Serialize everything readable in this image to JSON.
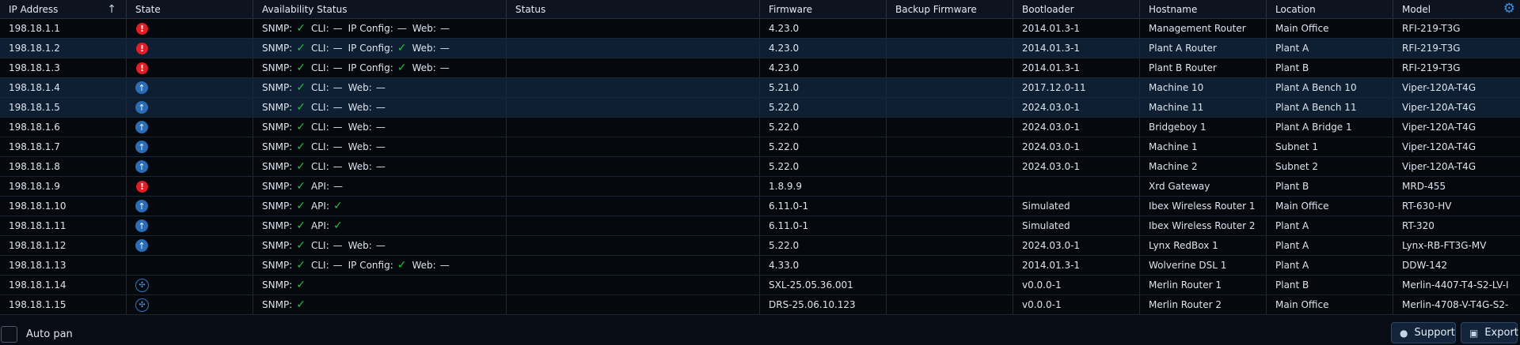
{
  "columns": [
    "IP Address",
    "State",
    "Availability Status",
    "Status",
    "Firmware",
    "Backup Firmware",
    "Bootloader",
    "Hostname",
    "Location",
    "Model"
  ],
  "sort_indicator": "↑",
  "rows": [
    {
      "ip": "198.18.1.1",
      "state": "alert",
      "avail": [
        [
          "SNMP:",
          "ok"
        ],
        [
          "CLI:",
          "—"
        ],
        [
          "IP Config:",
          "—"
        ],
        [
          "Web:",
          "—"
        ]
      ],
      "status": "",
      "firmware": "4.23.0",
      "backup": "",
      "bootloader": "2014.01.3-1",
      "hostname": "Management Router",
      "location": "Main Office",
      "model": "RFI-219-T3G",
      "selected": false
    },
    {
      "ip": "198.18.1.2",
      "state": "alert",
      "avail": [
        [
          "SNMP:",
          "ok"
        ],
        [
          "CLI:",
          "—"
        ],
        [
          "IP Config:",
          "ok"
        ],
        [
          "Web:",
          "—"
        ]
      ],
      "status": "",
      "firmware": "4.23.0",
      "backup": "",
      "bootloader": "2014.01.3-1",
      "hostname": "Plant A Router",
      "location": "Plant A",
      "model": "RFI-219-T3G",
      "selected": true
    },
    {
      "ip": "198.18.1.3",
      "state": "alert",
      "avail": [
        [
          "SNMP:",
          "ok"
        ],
        [
          "CLI:",
          "—"
        ],
        [
          "IP Config:",
          "ok"
        ],
        [
          "Web:",
          "—"
        ]
      ],
      "status": "",
      "firmware": "4.23.0",
      "backup": "",
      "bootloader": "2014.01.3-1",
      "hostname": "Plant B Router",
      "location": "Plant B",
      "model": "RFI-219-T3G",
      "selected": false
    },
    {
      "ip": "198.18.1.4",
      "state": "up",
      "avail": [
        [
          "SNMP:",
          "ok"
        ],
        [
          "CLI:",
          "—"
        ],
        [
          "Web:",
          "—"
        ]
      ],
      "status": "",
      "firmware": "5.21.0",
      "backup": "",
      "bootloader": "2017.12.0-11",
      "hostname": "Machine 10",
      "location": "Plant A Bench 10",
      "model": "Viper-120A-T4G",
      "selected": true
    },
    {
      "ip": "198.18.1.5",
      "state": "up",
      "avail": [
        [
          "SNMP:",
          "ok"
        ],
        [
          "CLI:",
          "—"
        ],
        [
          "Web:",
          "—"
        ]
      ],
      "status": "",
      "firmware": "5.22.0",
      "backup": "",
      "bootloader": "2024.03.0-1",
      "hostname": "Machine 11",
      "location": "Plant A Bench 11",
      "model": "Viper-120A-T4G",
      "selected": true
    },
    {
      "ip": "198.18.1.6",
      "state": "up",
      "avail": [
        [
          "SNMP:",
          "ok"
        ],
        [
          "CLI:",
          "—"
        ],
        [
          "Web:",
          "—"
        ]
      ],
      "status": "",
      "firmware": "5.22.0",
      "backup": "",
      "bootloader": "2024.03.0-1",
      "hostname": "Bridgeboy 1",
      "location": "Plant A Bridge 1",
      "model": "Viper-120A-T4G",
      "selected": false
    },
    {
      "ip": "198.18.1.7",
      "state": "up",
      "avail": [
        [
          "SNMP:",
          "ok"
        ],
        [
          "CLI:",
          "—"
        ],
        [
          "Web:",
          "—"
        ]
      ],
      "status": "",
      "firmware": "5.22.0",
      "backup": "",
      "bootloader": "2024.03.0-1",
      "hostname": "Machine 1",
      "location": "Subnet 1",
      "model": "Viper-120A-T4G",
      "selected": false
    },
    {
      "ip": "198.18.1.8",
      "state": "up",
      "avail": [
        [
          "SNMP:",
          "ok"
        ],
        [
          "CLI:",
          "—"
        ],
        [
          "Web:",
          "—"
        ]
      ],
      "status": "",
      "firmware": "5.22.0",
      "backup": "",
      "bootloader": "2024.03.0-1",
      "hostname": "Machine 2",
      "location": "Subnet 2",
      "model": "Viper-120A-T4G",
      "selected": false
    },
    {
      "ip": "198.18.1.9",
      "state": "alert",
      "avail": [
        [
          "SNMP:",
          "ok"
        ],
        [
          "API:",
          "—"
        ]
      ],
      "status": "",
      "firmware": "1.8.9.9",
      "backup": "",
      "bootloader": "",
      "hostname": "Xrd Gateway",
      "location": "Plant B",
      "model": "MRD-455",
      "selected": false
    },
    {
      "ip": "198.18.1.10",
      "state": "up",
      "avail": [
        [
          "SNMP:",
          "ok"
        ],
        [
          "API:",
          "ok"
        ]
      ],
      "status": "",
      "firmware": "6.11.0-1",
      "backup": "",
      "bootloader": "Simulated",
      "hostname": "Ibex Wireless Router 1",
      "location": "Main Office",
      "model": "RT-630-HV",
      "selected": false
    },
    {
      "ip": "198.18.1.11",
      "state": "up",
      "avail": [
        [
          "SNMP:",
          "ok"
        ],
        [
          "API:",
          "ok"
        ]
      ],
      "status": "",
      "firmware": "6.11.0-1",
      "backup": "",
      "bootloader": "Simulated",
      "hostname": "Ibex Wireless Router 2",
      "location": "Plant A",
      "model": "RT-320",
      "selected": false
    },
    {
      "ip": "198.18.1.12",
      "state": "up",
      "avail": [
        [
          "SNMP:",
          "ok"
        ],
        [
          "CLI:",
          "—"
        ],
        [
          "Web:",
          "—"
        ]
      ],
      "status": "",
      "firmware": "5.22.0",
      "backup": "",
      "bootloader": "2024.03.0-1",
      "hostname": "Lynx RedBox 1",
      "location": "Plant A",
      "model": "Lynx-RB-FT3G-MV",
      "selected": false
    },
    {
      "ip": "198.18.1.13",
      "state": "none",
      "avail": [
        [
          "SNMP:",
          "ok"
        ],
        [
          "CLI:",
          "—"
        ],
        [
          "IP Config:",
          "ok"
        ],
        [
          "Web:",
          "—"
        ]
      ],
      "status": "",
      "firmware": "4.33.0",
      "backup": "",
      "bootloader": "2014.01.3-1",
      "hostname": "Wolverine DSL 1",
      "location": "Plant A",
      "model": "DDW-142",
      "selected": false
    },
    {
      "ip": "198.18.1.14",
      "state": "network",
      "avail": [
        [
          "SNMP:",
          "ok"
        ]
      ],
      "status": "",
      "firmware": "SXL-25.05.36.001",
      "backup": "",
      "bootloader": "v0.0.0-1",
      "hostname": "Merlin Router 1",
      "location": "Plant B",
      "model": "Merlin-4407-T4-S2-LV-I",
      "selected": false
    },
    {
      "ip": "198.18.1.15",
      "state": "network",
      "avail": [
        [
          "SNMP:",
          "ok"
        ]
      ],
      "status": "",
      "firmware": "DRS-25.06.10.123",
      "backup": "",
      "bootloader": "v0.0.0-1",
      "hostname": "Merlin Router 2",
      "location": "Main Office",
      "model": "Merlin-4708-V-T4G-S2-",
      "selected": false
    }
  ],
  "footer": {
    "autopan_label": "Auto pan",
    "support_label": "Support",
    "export_label": "Export"
  },
  "colors": {
    "alert": "#e11d26",
    "up": "#2a6db5",
    "ok": "#26c142",
    "accent": "#3d8fe0"
  }
}
